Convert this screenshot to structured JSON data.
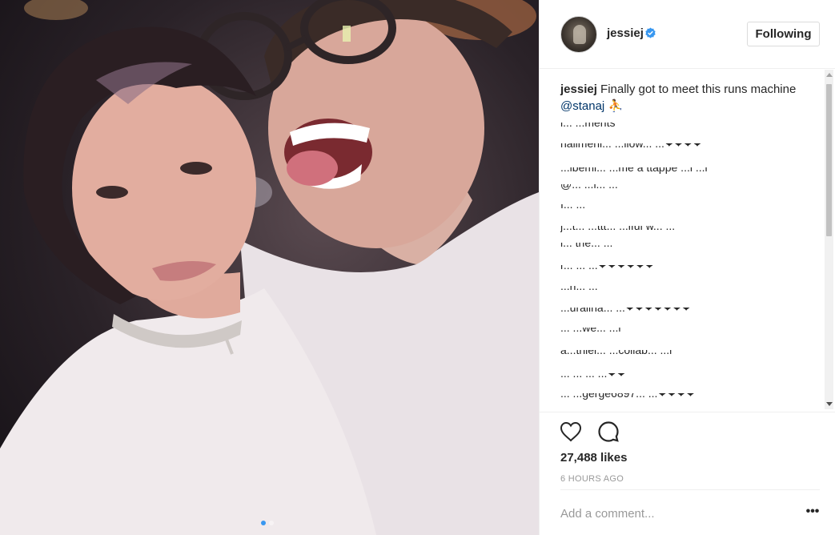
{
  "post": {
    "username": "jessiej",
    "verified": true,
    "follow_label": "Following",
    "caption_user": "jessiej",
    "caption_text": "Finally got to meet this runs machine",
    "caption_mention": "@stanaj",
    "caption_emoji": "⛹",
    "likes": "27,488 likes",
    "timestamp": "6 HOURS AGO",
    "comment_placeholder": "Add a comment...",
    "more_icon": "•••",
    "carousel_dots": 2,
    "active_dot": 0
  },
  "comments": [
    {
      "text": "l... ...ments"
    },
    {
      "text": "halimehi... ...llow... ...❤❤❤❤"
    },
    {
      "text": "...ibemi... ...me à ttappe ...l ...l"
    },
    {
      "text": "@... ...l... ..."
    },
    {
      "text": "I... ..."
    },
    {
      "text": "j...t... ...ttt... ...iful w... ..."
    },
    {
      "text": "i... the... ..."
    },
    {
      "text": "r... ... ...❤❤❤❤❤❤"
    },
    {
      "text": "...n... ..."
    },
    {
      "text": "...uralina... ...❤❤❤❤❤❤❤"
    },
    {
      "text": "... ...we... ...l"
    },
    {
      "text": "a...thiel... ...collab... ...l"
    },
    {
      "text": "... ... ... ...❤❤"
    },
    {
      "text": "... ...gerge6897... ...❤❤❤❤"
    }
  ],
  "colors": {
    "verified_badge": "#3897f0",
    "mention": "#003569",
    "muted": "#999999",
    "border": "#efefef"
  },
  "icons": {
    "like": "heart-icon",
    "comment": "speech-bubble-icon",
    "verified": "verified-badge-icon",
    "more": "ellipsis-icon"
  }
}
